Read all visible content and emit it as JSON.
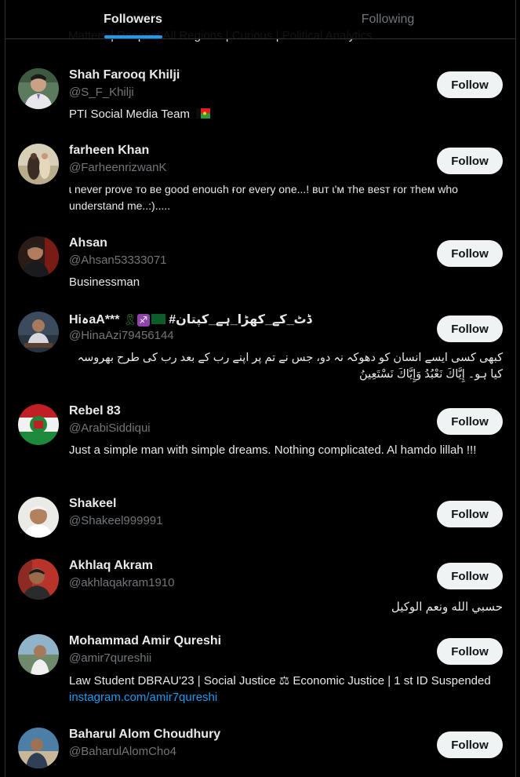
{
  "tabs": [
    {
      "label": "Followers",
      "active": true
    },
    {
      "label": "Following",
      "active": false
    }
  ],
  "partial_bio": "Matters | Respect All Regions | Curious | Political Analytics",
  "follow_label": "Follow",
  "users": [
    {
      "name": "Shah Farooq Khilji",
      "handle": "@S_F_Khilji",
      "bio": "PTI Social Media Team"
    },
    {
      "name": "farheen Khan",
      "handle": "@FarheenrizwanK",
      "bio": "ɩ never prove ᴛo ʙe good enouɢh ғor every one...! ʙuᴛ ɩ'ᴍ ᴛhe ʙesᴛ ғor ᴛheᴍ who understand me..:)....."
    },
    {
      "name": "Ahsan",
      "handle": "@Ahsan53333071",
      "bio": "Businessman"
    },
    {
      "name": "HiہaA***",
      "name_suffix": "ڈٹ_کے_کھڑا_ہے_کپتان#",
      "handle": "@HinaAzi79456144",
      "bio": "کبھی کسی ایسے انسان کو دھوکہ نہ دو، جس نے تم پر اپنے رب کے بعد رب کی طرح بھروسہ کیا ہو۔ إِيَّاكَ نَعْبُدُ وَإِيَّاكَ نَسْتَعِينُ"
    },
    {
      "name": "Rebel 83",
      "handle": "@ArabiSiddiqui",
      "bio": "Just a simple man with simple dreams. Nothing complicated. Al hamdo lillah !!!"
    },
    {
      "name": "Shakeel",
      "handle": "@Shakeel999991",
      "bio": ""
    },
    {
      "name": "Akhlaq Akram",
      "handle": "@akhlaqakram1910",
      "bio": "حسبي الله ونعم الوكيل"
    },
    {
      "name": "Mohammad Amir Qureshi",
      "handle": "@amir7qureshii",
      "bio": "Law Student DBRAU'23 | Social Justice ⚖ Economic Justice | 1 st ID Suspended",
      "link": "instagram.com/amir7qureshi"
    },
    {
      "name": "Baharul Alom Choudhury",
      "handle": "@BaharulAlomCho4",
      "bio": ""
    }
  ],
  "colors": {
    "background": "#000000",
    "accent": "#1d9bf0",
    "secondary_text": "#71767b",
    "button_bg": "#eff3f4"
  }
}
